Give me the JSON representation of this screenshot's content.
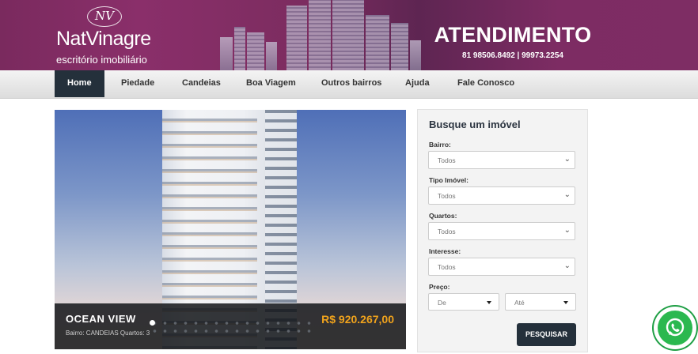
{
  "header": {
    "logo_mark": "NV",
    "logo_name": "NatVinagre",
    "logo_sub": "escritório imobiliário",
    "attendance_title": "ATENDIMENTO",
    "attendance_phone": "81 98506.8492 | 99973.2254"
  },
  "nav": {
    "items": [
      {
        "label": "Home",
        "active": true
      },
      {
        "label": "Piedade"
      },
      {
        "label": "Candeias"
      },
      {
        "label": "Boa Viagem"
      },
      {
        "label": "Outros bairros"
      },
      {
        "label": "Ajuda"
      },
      {
        "label": "Fale Conosco"
      }
    ]
  },
  "slider": {
    "title": "OCEAN VIEW",
    "meta": "Bairro: CANDEIAS    Quartos: 3",
    "price": "R$ 920.267,00"
  },
  "search": {
    "title": "Busque um imóvel",
    "fields": [
      {
        "label": "Bairro:",
        "value": "Todos"
      },
      {
        "label": "Tipo Imóvel:",
        "value": "Todos"
      },
      {
        "label": "Quartos:",
        "value": "Todos"
      },
      {
        "label": "Interesse:",
        "value": "Todos"
      }
    ],
    "price_label": "Preço:",
    "price_from": "De",
    "price_to": "Até",
    "button": "PESQUISAR"
  },
  "icons": {
    "whatsapp": "whatsapp-icon",
    "chevron": "chevron-down-icon"
  },
  "colors": {
    "header_purple": "#7a2a5e",
    "nav_active": "#24303b",
    "price_orange": "#f0a31c",
    "whatsapp_green": "#2bb84f"
  }
}
